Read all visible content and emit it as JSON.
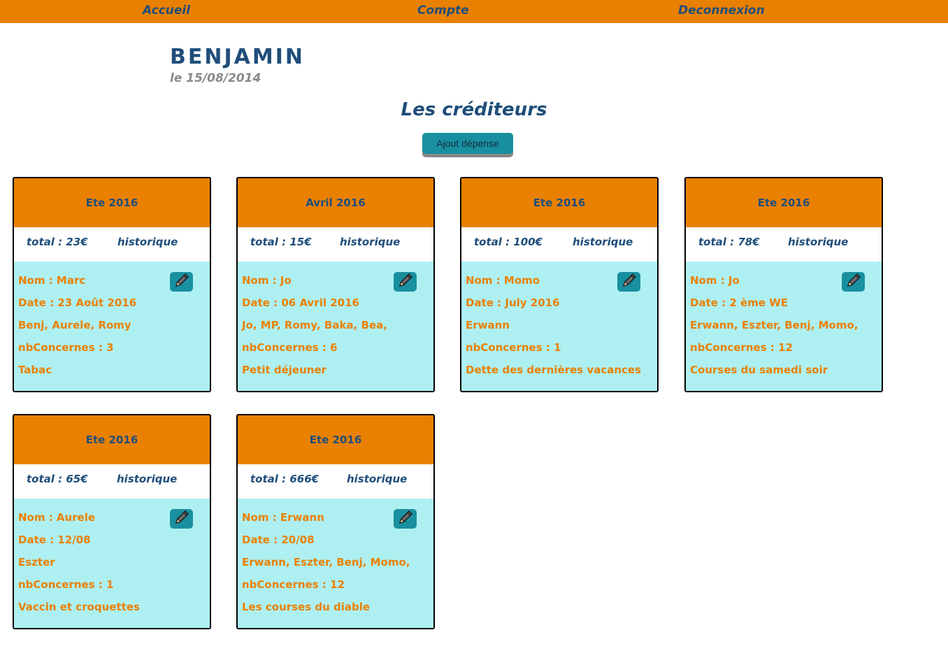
{
  "nav": {
    "home": "Accueil",
    "account": "Compte",
    "logout": "Deconnexion"
  },
  "user": {
    "name": "BENJAMIN",
    "date": "le 15/08/2014"
  },
  "page_title": "Les créditeurs",
  "add_button": "Ajout dépense",
  "history_label": "historique",
  "cards": [
    {
      "period": "Ete 2016",
      "total": "total : 23€",
      "nom": "Nom : Marc",
      "date": "Date : 23 Août 2016",
      "people": "Benj, Aurele, Romy",
      "nb": "nbConcernes : 3",
      "desc": "Tabac"
    },
    {
      "period": "Avril 2016",
      "total": "total : 15€",
      "nom": "Nom : Jo",
      "date": "Date : 06 Avril 2016",
      "people": "Jo, MP, Romy, Baka, Bea,",
      "nb": "nbConcernes : 6",
      "desc": "Petit déjeuner"
    },
    {
      "period": "Ete 2016",
      "total": "total : 100€",
      "nom": "Nom : Momo",
      "date": "Date : July 2016",
      "people": "Erwann",
      "nb": "nbConcernes : 1",
      "desc": "Dette des dernières vacances"
    },
    {
      "period": "Ete 2016",
      "total": "total : 78€",
      "nom": "Nom : Jo",
      "date": "Date : 2 ème WE",
      "people": "Erwann, Eszter, Benj, Momo,",
      "nb": "nbConcernes : 12",
      "desc": "Courses du samedi soir"
    },
    {
      "period": "Ete 2016",
      "total": "total : 65€",
      "nom": "Nom : Aurele",
      "date": "Date : 12/08",
      "people": "Eszter",
      "nb": "nbConcernes : 1",
      "desc": "Vaccin et croquettes"
    },
    {
      "period": "Ete 2016",
      "total": "total : 666€",
      "nom": "Nom : Erwann",
      "date": "Date : 20/08",
      "people": "Erwann, Eszter, Benj, Momo,",
      "nb": "nbConcernes : 12",
      "desc": "Les courses du diable"
    }
  ],
  "colors": {
    "accent": "#ea8000",
    "navy": "#1f4e7a",
    "teal": "#19909f",
    "card_body": "#aef0f2"
  },
  "icons": {
    "edit": "pencil-icon"
  }
}
